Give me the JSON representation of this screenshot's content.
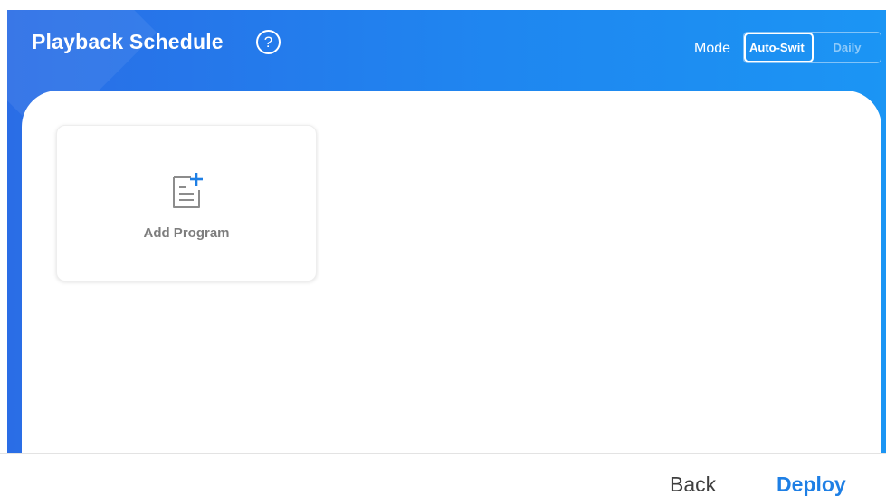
{
  "header": {
    "title": "Playback Schedule",
    "help_glyph": "?",
    "help_icon": "question-circle-icon",
    "mode_label": "Mode",
    "mode_options": [
      {
        "label": "Auto-Swit",
        "selected": true
      },
      {
        "label": "Daily",
        "selected": false
      }
    ],
    "colors": {
      "gradient_start": "#2a6de6",
      "gradient_end": "#1b95f4"
    }
  },
  "main": {
    "program_card": {
      "label": "Add Program",
      "icon": "document-add-icon",
      "icon_accent": "#1e7fe5"
    }
  },
  "footer": {
    "back_label": "Back",
    "deploy_label": "Deploy",
    "deploy_color": "#1e7fe5"
  }
}
